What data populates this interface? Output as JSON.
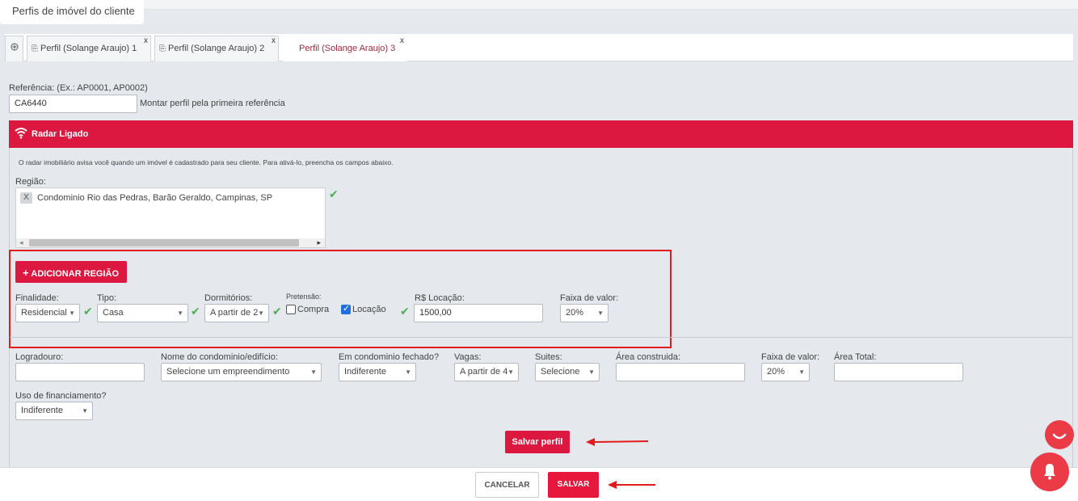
{
  "page_title": "Perfis de imóvel do cliente",
  "tabs": [
    {
      "label": "Perfil (Solange Araujo) 1",
      "close": "x"
    },
    {
      "label": "Perfil (Solange Araujo) 2",
      "close": "x"
    },
    {
      "label": "Perfil (Solange Araujo) 3",
      "close": "x"
    }
  ],
  "add_tab_icon": "plus-circle-icon",
  "referencia": {
    "label": "Referência: (Ex.: AP0001, AP0002)",
    "value": "CA6440",
    "hint": "Montar perfil pela primeira referência"
  },
  "radar": {
    "title": "Radar Ligado",
    "icon": "wifi-icon",
    "description": "O radar imobiliário avisa você quando um imóvel é cadastrado para seu cliente. Para ativá-lo, preencha os campos abaixo."
  },
  "regiao": {
    "label": "Região:",
    "chip_remove": "X",
    "chip": "Condominio Rio das Pedras, Barão Geraldo, Campinas, SP",
    "scroll_left": "◂",
    "scroll_right": "▸"
  },
  "add_region_button": "ADICIONAR REGIÃO",
  "add_region_icon": "+",
  "filters": {
    "finalidade": {
      "label": "Finalidade:",
      "value": "Residencial"
    },
    "tipo": {
      "label": "Tipo:",
      "value": "Casa"
    },
    "dormitorios": {
      "label": "Dormitórios:",
      "value": "A partir de 2"
    },
    "pretensao": {
      "label": "Pretensão:",
      "compra": "Compra",
      "compra_checked": false,
      "locacao": "Locação",
      "locacao_checked": true
    },
    "locacao_valor": {
      "label": "R$ Locação:",
      "value": "1500,00"
    },
    "faixa_valor": {
      "label": "Faixa de valor:",
      "value": "20%"
    }
  },
  "extra": {
    "logradouro": {
      "label": "Logradouro:",
      "value": ""
    },
    "condominio": {
      "label": "Nome do condominio/edifício:",
      "value": "Selecione um empreendimento"
    },
    "cond_fechado": {
      "label": "Em condominio fechado?",
      "value": "Indiferente"
    },
    "vagas": {
      "label": "Vagas:",
      "value": "A partir de 4"
    },
    "suites": {
      "label": "Suites:",
      "value": "Selecione"
    },
    "area_construida": {
      "label": "Área construida:",
      "value": ""
    },
    "faixa_valor2": {
      "label": "Faixa de valor:",
      "value": "20%"
    },
    "area_total": {
      "label": "Área Total:",
      "value": ""
    },
    "financiamento": {
      "label": "Uso de financiamento?",
      "value": "Indiferente"
    }
  },
  "buttons": {
    "salvar_perfil": "Salvar perfil",
    "cancelar": "CANCELAR",
    "salvar": "SALVAR"
  },
  "colors": {
    "accent": "#dc1840",
    "check": "#4caf50",
    "annotation": "#e21b1b"
  }
}
